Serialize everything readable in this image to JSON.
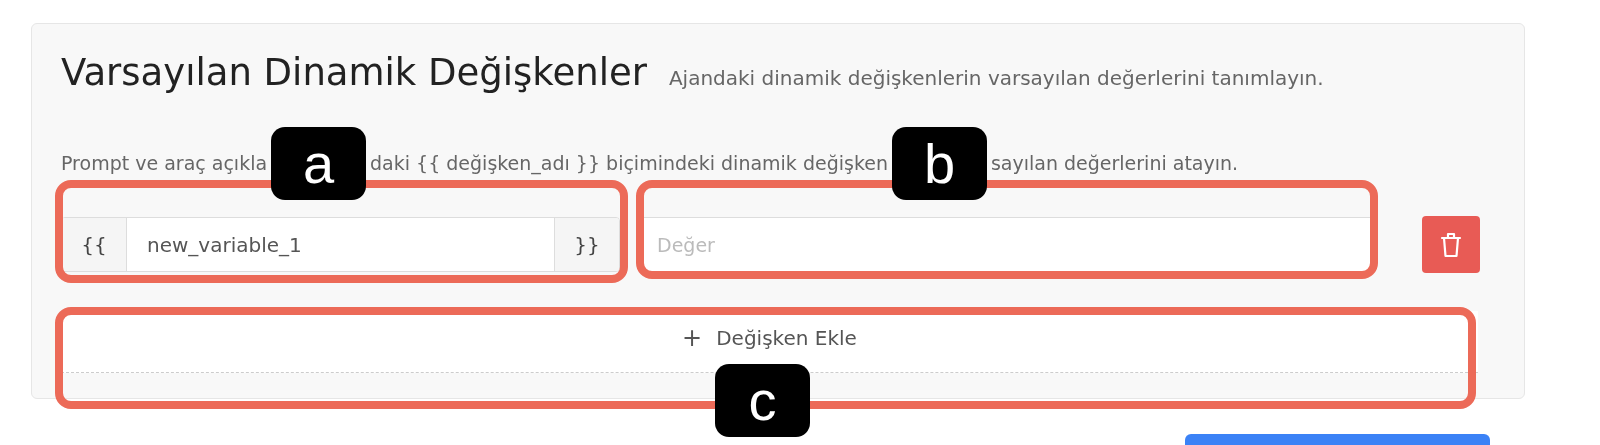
{
  "panel": {
    "title": "Varsayılan Dinamik Değişkenler",
    "subtitle": "Ajandaki dinamik değişkenlerin varsayılan değerlerini tanımlayın.",
    "hint_parts": [
      "Prompt ve araç açıkla",
      "daki {{ değişken_adı }} biçimindeki dinamik değişken",
      "sayılan değerlerini atayın."
    ],
    "variables": [
      {
        "prefix": "{{",
        "name": "new_variable_1",
        "suffix": "}}",
        "value_placeholder": "Değer"
      }
    ],
    "add_button": {
      "icon": "+",
      "label": "Değişken Ekle"
    }
  },
  "annotations": [
    "a",
    "b",
    "c"
  ]
}
